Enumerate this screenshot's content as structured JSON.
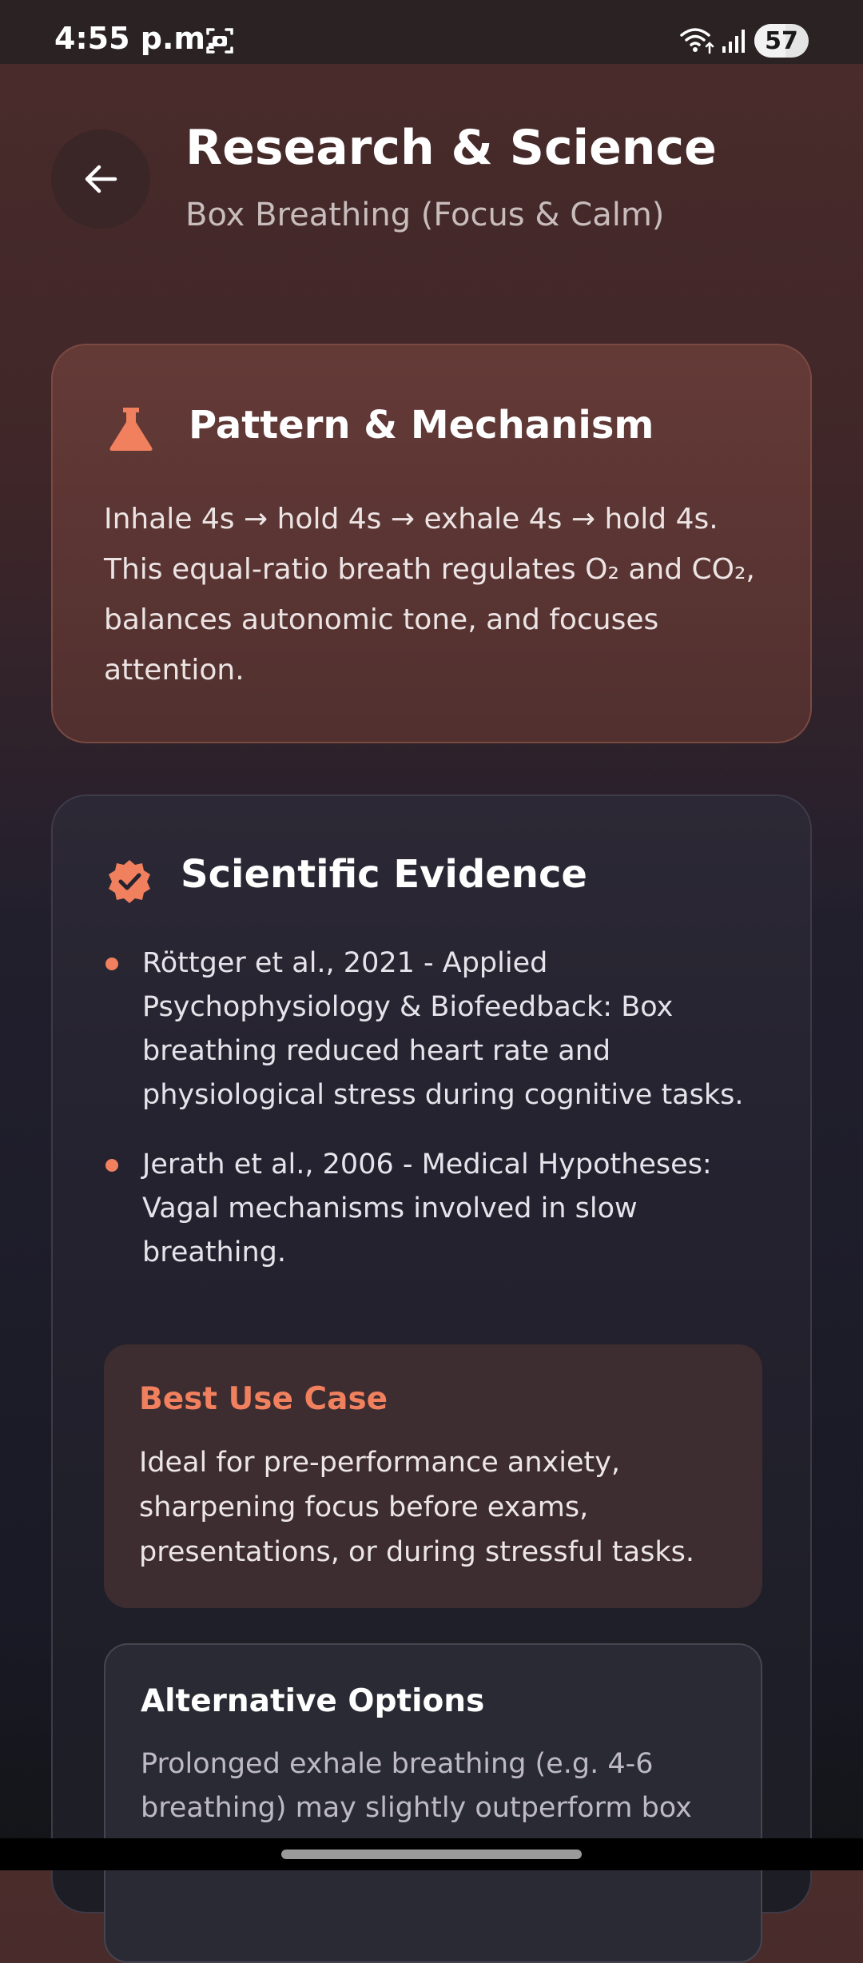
{
  "status_bar": {
    "time": "4:55 p.m.",
    "battery_level": "57",
    "battery_fraction": 0.57
  },
  "header": {
    "title": "Research & Science",
    "subtitle": "Box Breathing (Focus & Calm)"
  },
  "pattern_card": {
    "title": "Pattern & Mechanism",
    "body_lines": [
      "Inhale 4s → hold 4s → exhale 4s → hold 4s.",
      "This equal-ratio breath regulates O₂ and CO₂,",
      "balances autonomic tone, and focuses",
      "attention."
    ]
  },
  "evidence_card": {
    "title": "Scientific Evidence",
    "items": [
      {
        "lines": [
          "Röttger et al., 2021 - Applied",
          "Psychophysiology & Biofeedback: Box",
          "breathing reduced heart rate and",
          "physiological stress during cognitive tasks."
        ]
      },
      {
        "lines": [
          "Jerath et al., 2006 - Medical Hypotheses:",
          "Vagal mechanisms involved in slow",
          "breathing."
        ]
      }
    ],
    "use_case": {
      "title": "Best Use Case",
      "lines": [
        "Ideal for pre-performance anxiety,",
        "sharpening focus before exams,",
        "presentations, or during stressful tasks."
      ]
    },
    "alternatives": {
      "title": "Alternative Options",
      "lines": [
        "Prolonged exhale breathing (e.g. 4-6",
        "breathing) may slightly outperform box"
      ]
    }
  },
  "icons": {
    "back": "arrow-left-icon",
    "pattern": "flask-icon",
    "evidence": "verified-badge-icon"
  },
  "colors": {
    "accent": "#f0805e",
    "pattern_card_bg": "#5a3533",
    "evidence_card_bg": "#25232f",
    "use_case_bg": "#3d2c30"
  }
}
